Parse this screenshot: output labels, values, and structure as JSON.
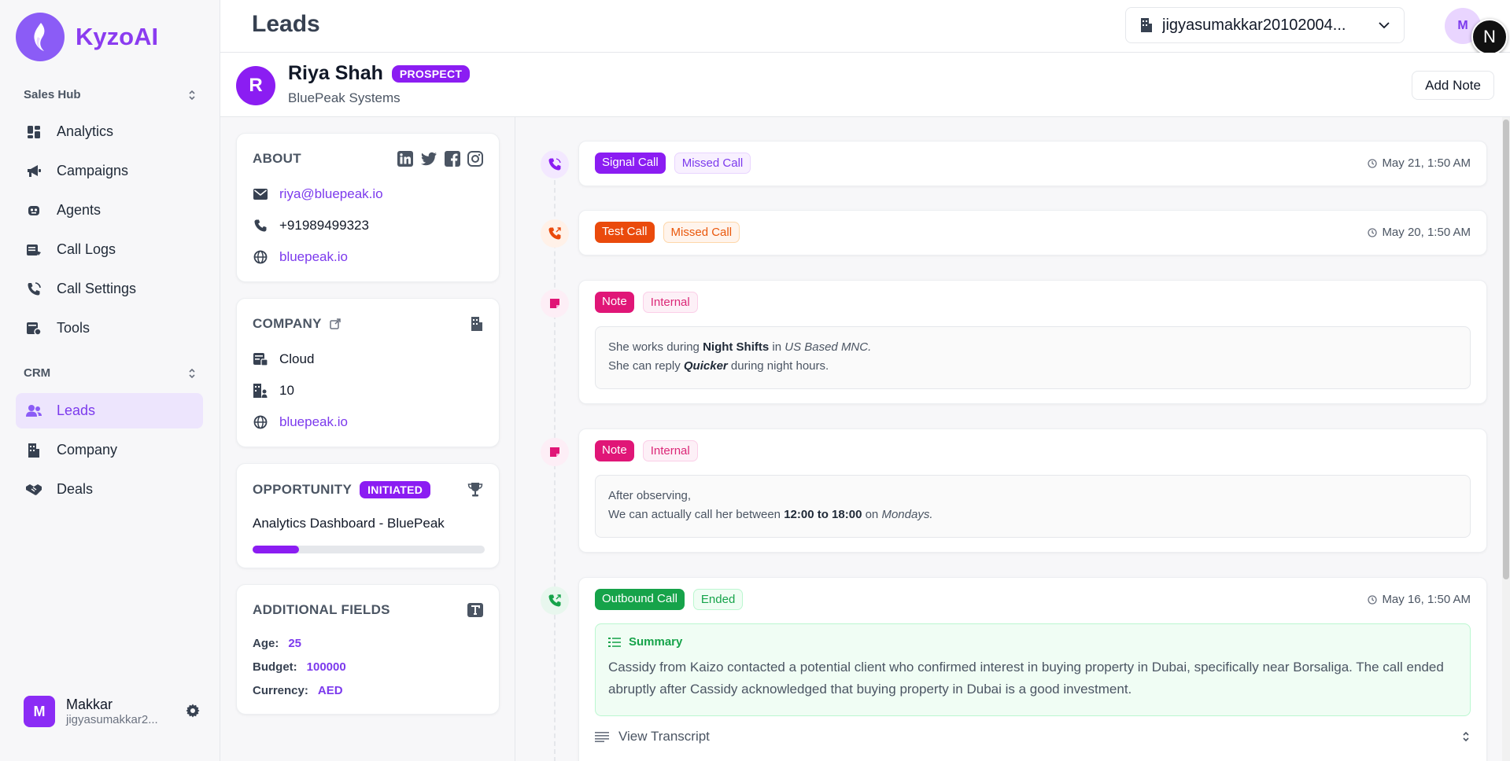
{
  "app": {
    "brand": "KyzoAI"
  },
  "sidebar": {
    "sections": [
      {
        "label": "Sales Hub"
      },
      {
        "label": "CRM"
      }
    ],
    "sales_items": [
      {
        "label": "Analytics",
        "icon": "analytics-icon"
      },
      {
        "label": "Campaigns",
        "icon": "megaphone-icon"
      },
      {
        "label": "Agents",
        "icon": "robot-icon"
      },
      {
        "label": "Call Logs",
        "icon": "call-logs-icon"
      },
      {
        "label": "Call Settings",
        "icon": "phone-settings-icon"
      },
      {
        "label": "Tools",
        "icon": "tools-icon"
      }
    ],
    "crm_items": [
      {
        "label": "Leads",
        "icon": "users-icon",
        "active": true
      },
      {
        "label": "Company",
        "icon": "building-icon"
      },
      {
        "label": "Deals",
        "icon": "handshake-icon"
      }
    ],
    "user": {
      "initial": "M",
      "name": "Makkar",
      "email": "jigyasumakkar2..."
    }
  },
  "header": {
    "title": "Leads",
    "org": "jigyasumakkar20102004...",
    "avatar_initial": "M",
    "badge_initial": "N"
  },
  "lead": {
    "initial": "R",
    "name": "Riya Shah",
    "status": "PROSPECT",
    "company": "BluePeak Systems",
    "add_note_label": "Add Note"
  },
  "about": {
    "title": "ABOUT",
    "email": "riya@bluepeak.io",
    "phone": "+91989499323",
    "website": "bluepeak.io"
  },
  "company": {
    "title": "COMPANY",
    "industry": "Cloud",
    "size": "10",
    "website": "bluepeak.io"
  },
  "opportunity": {
    "title": "OPPORTUNITY",
    "status": "INITIATED",
    "name": "Analytics Dashboard - BluePeak",
    "progress_percent": 20
  },
  "additional": {
    "title": "ADDITIONAL FIELDS",
    "fields": [
      {
        "label": "Age:",
        "value": "25"
      },
      {
        "label": "Budget:",
        "value": "100000"
      },
      {
        "label": "Currency:",
        "value": "AED"
      }
    ]
  },
  "timeline": [
    {
      "type": "Signal Call",
      "status": "Missed Call",
      "time": "May 21, 1:50 AM",
      "color": "#8b1df2"
    },
    {
      "type": "Test Call",
      "status": "Missed Call",
      "time": "May 20, 1:50 AM",
      "color": "#ea4a0c"
    },
    {
      "type": "Note",
      "status": "Internal",
      "color": "#e01677",
      "line1": {
        "t1": "She works during ",
        "b1": "Night Shifts",
        "t2": " in ",
        "i1": "US Based MNC."
      },
      "line2": {
        "t1": "She can reply ",
        "bi1": "Quicker",
        "t2": " during night hours."
      }
    },
    {
      "type": "Note",
      "status": "Internal",
      "color": "#e01677",
      "line1": {
        "t1": "After observing,"
      },
      "line2": {
        "t1": "We can actually call her between ",
        "b1": "12:00 to 18:00",
        "t2": " on ",
        "i1": "Mondays."
      }
    },
    {
      "type": "Outbound Call",
      "status": "Ended",
      "time": "May 16, 1:50 AM",
      "color": "#16a34a",
      "summary_title": "Summary",
      "summary": "Cassidy from Kaizo contacted a potential client who confirmed interest in buying property in Dubai, specifically near Borsaliga. The call ended abruptly after Cassidy acknowledged that buying property in Dubai is a good investment.",
      "transcript_label": "View Transcript"
    }
  ]
}
